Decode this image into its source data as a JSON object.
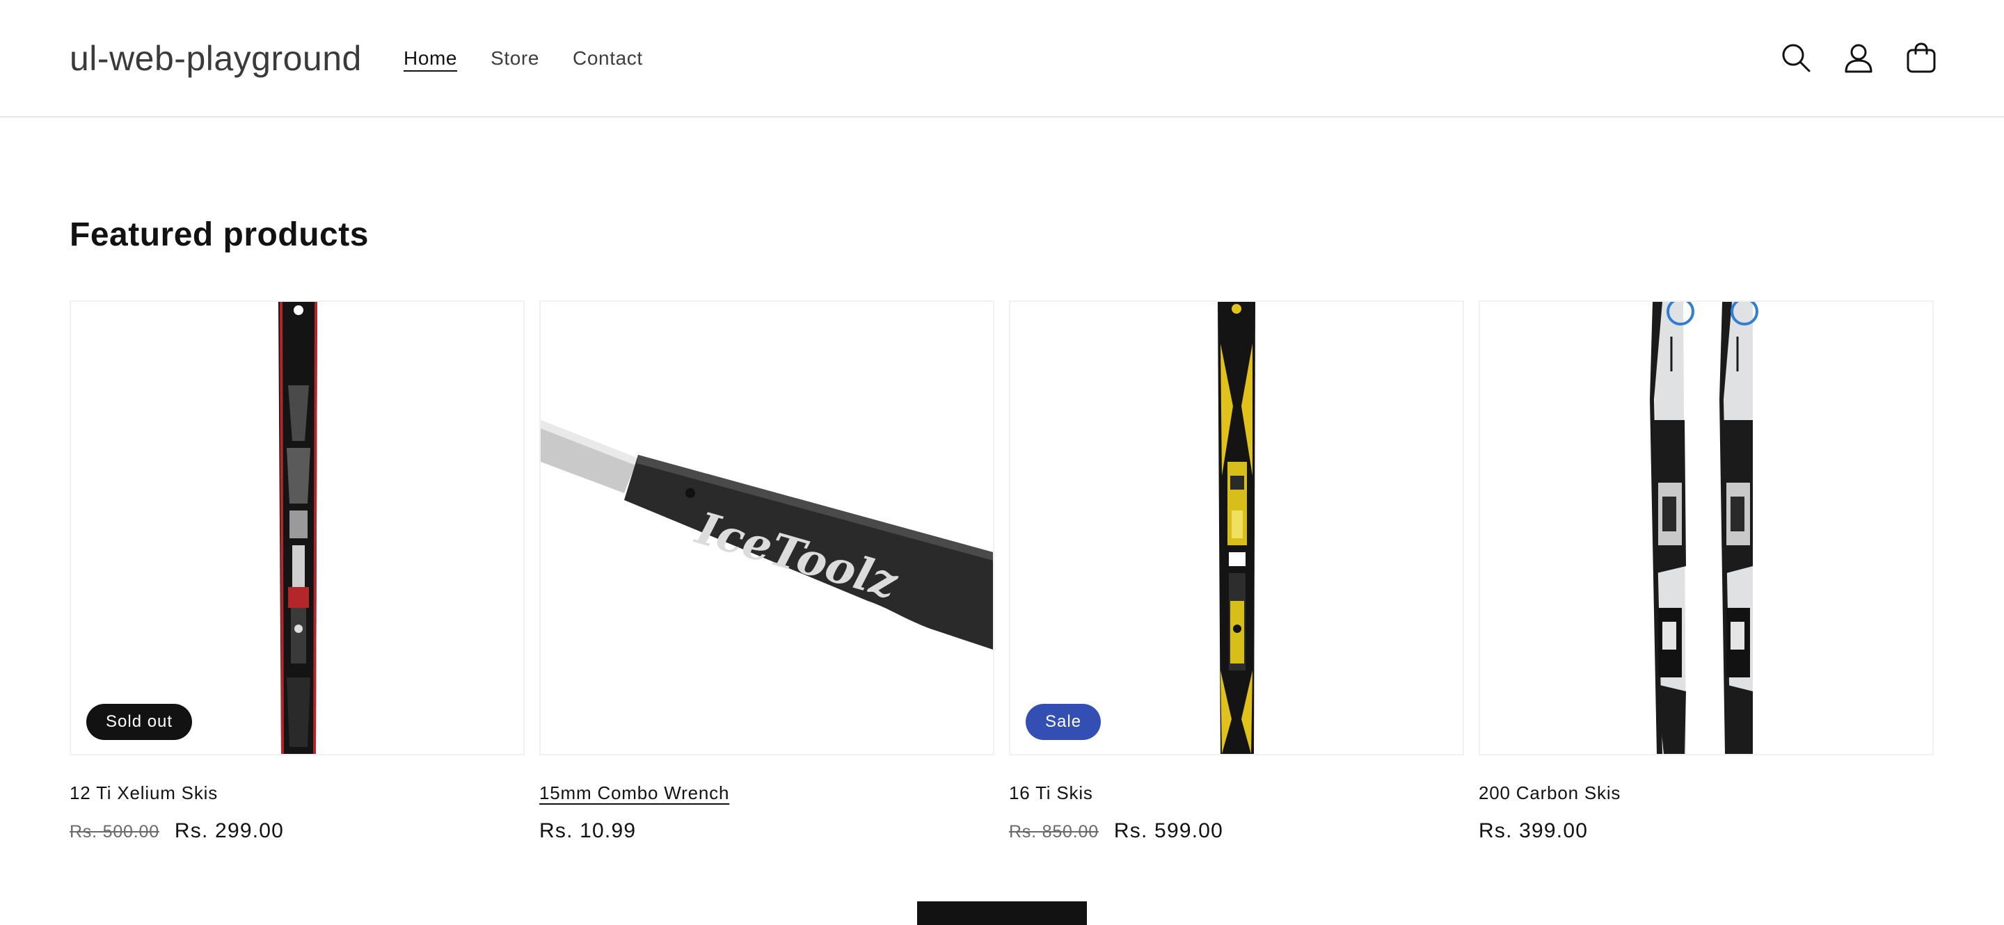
{
  "header": {
    "logo": "ul-web-playground",
    "nav": [
      {
        "label": "Home",
        "active": true
      },
      {
        "label": "Store",
        "active": false
      },
      {
        "label": "Contact",
        "active": false
      }
    ],
    "icons": [
      "search-icon",
      "account-icon",
      "cart-icon"
    ]
  },
  "featured": {
    "title": "Featured products",
    "products": [
      {
        "name": "12 Ti Xelium Skis",
        "price_old": "Rs. 500.00",
        "price": "Rs. 299.00",
        "badge": "Sold out"
      },
      {
        "name": "15mm Combo Wrench",
        "price_old": "",
        "price": "Rs. 10.99",
        "badge": ""
      },
      {
        "name": "16 Ti Skis",
        "price_old": "Rs. 850.00",
        "price": "Rs. 599.00",
        "badge": "Sale"
      },
      {
        "name": "200 Carbon Skis",
        "price_old": "",
        "price": "Rs. 399.00",
        "badge": ""
      }
    ],
    "wrench_print": "IceToolz"
  },
  "colors": {
    "text": "#121212",
    "sale_badge": "#334fb4",
    "soldout_badge": "#121212",
    "border": "#e6e6e6"
  }
}
